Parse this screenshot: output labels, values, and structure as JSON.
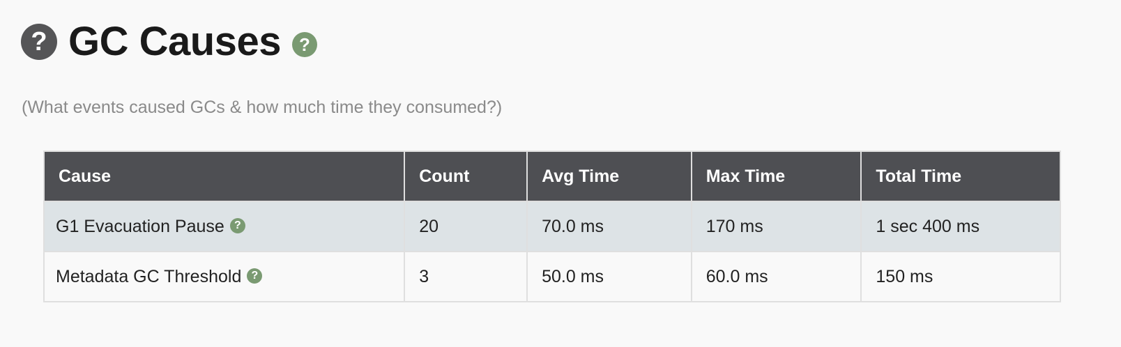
{
  "header": {
    "help_glyph": "?",
    "title": "GC Causes",
    "title_help_glyph": "?",
    "subtitle": "(What events caused GCs & how much time they consumed?)"
  },
  "table": {
    "columns": [
      "Cause",
      "Count",
      "Avg Time",
      "Max Time",
      "Total Time"
    ],
    "rows": [
      {
        "cause": "G1 Evacuation Pause",
        "help_glyph": "?",
        "count": "20",
        "avg_time": "70.0 ms",
        "max_time": "170 ms",
        "total_time": "1 sec 400 ms"
      },
      {
        "cause": "Metadata GC Threshold",
        "help_glyph": "?",
        "count": "3",
        "avg_time": "50.0 ms",
        "max_time": "60.0 ms",
        "total_time": "150 ms"
      }
    ]
  },
  "colors": {
    "header_bg": "#4e4f53",
    "row_alt_bg": "#dde3e6",
    "help_green": "#7a9a72",
    "help_dark": "#555557"
  },
  "icons": {
    "section_help": "question-circle-dark-icon",
    "title_help": "question-circle-green-icon",
    "row_help": "question-circle-green-icon"
  }
}
